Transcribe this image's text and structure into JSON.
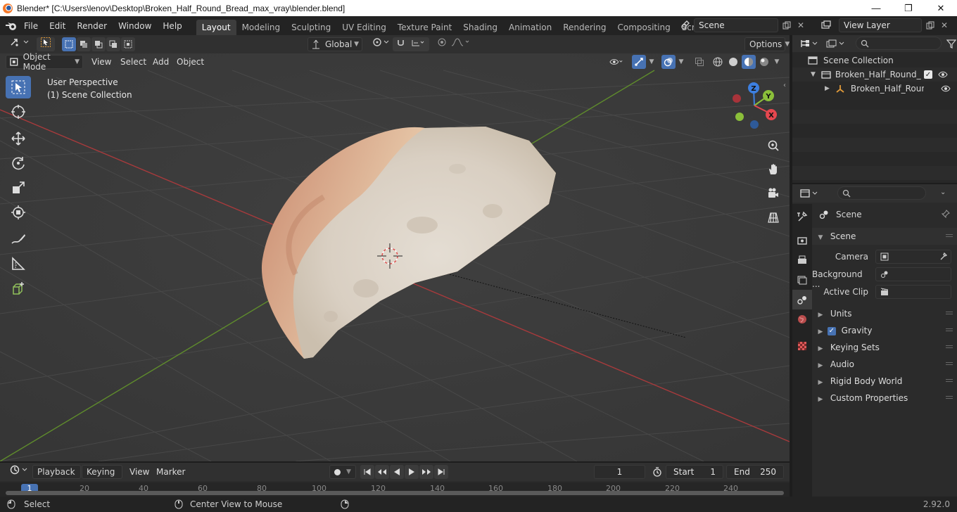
{
  "window": {
    "title": "Blender* [C:\\Users\\lenov\\Desktop\\Broken_Half_Round_Bread_max_vray\\blender.blend]",
    "min": "—",
    "max": "❐",
    "close": "✕"
  },
  "menubar": {
    "items": [
      "File",
      "Edit",
      "Render",
      "Window",
      "Help"
    ],
    "workspaces": [
      "Layout",
      "Modeling",
      "Sculpting",
      "UV Editing",
      "Texture Paint",
      "Shading",
      "Animation",
      "Rendering",
      "Compositing",
      "Scripting"
    ],
    "active_workspace": "Layout",
    "add_tab": "+",
    "scene": "Scene",
    "view_layer": "View Layer"
  },
  "viewport_header": {
    "orientation": "Global",
    "options": "Options",
    "mode": "Object Mode",
    "menus": [
      "View",
      "Select",
      "Add",
      "Object"
    ]
  },
  "viewport": {
    "perspective": "User Perspective",
    "collection": "(1) Scene Collection",
    "gizmo": {
      "x": "X",
      "y": "Y",
      "z": "Z"
    }
  },
  "outliner": {
    "root": "Scene Collection",
    "items": [
      {
        "label": "Broken_Half_Round_Brea"
      },
      {
        "label": "Broken_Half_Round_"
      }
    ]
  },
  "properties": {
    "context": "Scene",
    "panel": "Scene",
    "rows": [
      {
        "label": "Camera"
      },
      {
        "label": "Background ..."
      },
      {
        "label": "Active Clip"
      }
    ],
    "sections": [
      "Units",
      "Gravity",
      "Keying Sets",
      "Audio",
      "Rigid Body World",
      "Custom Properties"
    ],
    "gravity_checked": true
  },
  "timeline": {
    "menus": [
      "Playback",
      "Keying",
      "View",
      "Marker"
    ],
    "current_frame": "1",
    "start_label": "Start",
    "start": "1",
    "end_label": "End",
    "end": "250",
    "ruler": [
      "1",
      "20",
      "40",
      "60",
      "80",
      "100",
      "120",
      "140",
      "160",
      "180",
      "200",
      "220",
      "240"
    ]
  },
  "status": {
    "left": "Select",
    "middle": "Center View to Mouse",
    "version": "2.92.0"
  },
  "colors": {
    "accent": "#4772b3",
    "grid_x": "#b23a3a",
    "grid_y": "#6a9a2a",
    "axis_x": "#e5474f",
    "axis_y": "#8bbf3a",
    "axis_z": "#3d7fe0"
  }
}
